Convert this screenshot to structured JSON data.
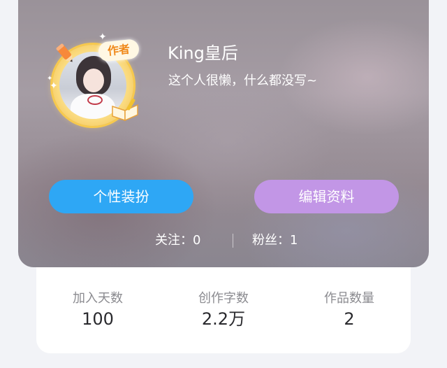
{
  "profile": {
    "badge": "作者",
    "name": "King皇后",
    "bio": "这个人很懒，什么都没写~"
  },
  "buttons": {
    "dress_up": "个性装扮",
    "edit_profile": "编辑资料"
  },
  "social": {
    "following": "关注：0",
    "fans": "粉丝：1"
  },
  "stats": [
    {
      "label": "加入天数",
      "value": "100"
    },
    {
      "label": "创作字数",
      "value": "2.2万"
    },
    {
      "label": "作品数量",
      "value": "2"
    }
  ],
  "colors": {
    "accent_blue": "#2ea7f5",
    "accent_purple": "#c296e6",
    "top_strip": "#1ea5ee"
  }
}
